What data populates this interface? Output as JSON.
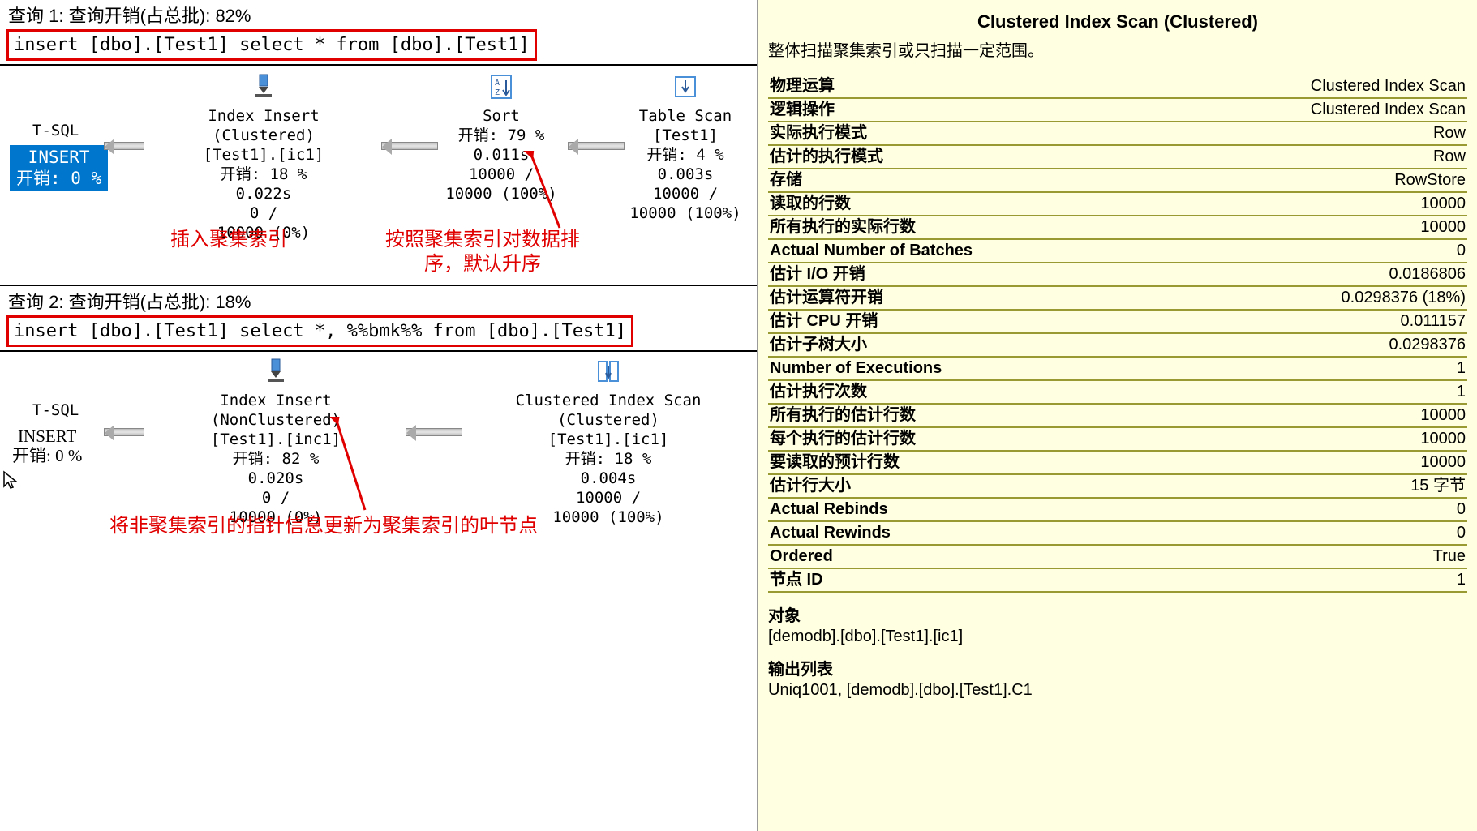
{
  "q1": {
    "header": "查询 1: 查询开销(占总批): 82%",
    "sql": "insert [dbo].[Test1] select * from [dbo].[Test1]",
    "tsql": "T-SQL",
    "insert_label": "INSERT",
    "insert_cost": "开销: 0 %",
    "op_index": {
      "title": "Index Insert (Clustered)",
      "obj": "[Test1].[ic1]",
      "cost": "开销: 18 %",
      "time": "0.022s",
      "rows1": "0 /",
      "rows2": "10000 (0%)"
    },
    "op_sort": {
      "title": "Sort",
      "cost": "开销: 79 %",
      "time": "0.011s",
      "rows1": "10000 /",
      "rows2": "10000 (100%)"
    },
    "op_scan": {
      "title": "Table Scan",
      "obj": "[Test1]",
      "cost": "开销: 4 %",
      "time": "0.003s",
      "rows1": "10000 /",
      "rows2": "10000 (100%)"
    },
    "note1": "插入聚集索引",
    "note2a": "按照聚集索引对数据排",
    "note2b": "序，默认升序"
  },
  "q2": {
    "header": "查询 2: 查询开销(占总批): 18%",
    "sql": "insert [dbo].[Test1] select *, %%bmk%% from [dbo].[Test1]",
    "tsql": "T-SQL",
    "insert_label": "INSERT",
    "insert_cost": "开销: 0 %",
    "op_index": {
      "title": "Index Insert (NonClustered)",
      "obj": "[Test1].[inc1]",
      "cost": "开销: 82 %",
      "time": "0.020s",
      "rows1": "0 /",
      "rows2": "10000 (0%)"
    },
    "op_scan": {
      "title": "Clustered Index Scan (Clustered)",
      "obj": "[Test1].[ic1]",
      "cost": "开销: 18 %",
      "time": "0.004s",
      "rows1": "10000 /",
      "rows2": "10000 (100%)"
    },
    "note": "将非聚集索引的指针信息更新为聚集索引的叶节点"
  },
  "right": {
    "title": "Clustered Index Scan (Clustered)",
    "desc": "整体扫描聚集索引或只扫描一定范围。",
    "props": [
      {
        "k": "物理运算",
        "v": "Clustered Index Scan"
      },
      {
        "k": "逻辑操作",
        "v": "Clustered Index Scan"
      },
      {
        "k": "实际执行模式",
        "v": "Row"
      },
      {
        "k": "估计的执行模式",
        "v": "Row"
      },
      {
        "k": "存储",
        "v": "RowStore"
      },
      {
        "k": "读取的行数",
        "v": "10000"
      },
      {
        "k": "所有执行的实际行数",
        "v": "10000"
      },
      {
        "k": "Actual Number of Batches",
        "v": "0"
      },
      {
        "k": "估计 I/O 开销",
        "v": "0.0186806"
      },
      {
        "k": "估计运算符开销",
        "v": "0.0298376 (18%)"
      },
      {
        "k": "估计 CPU 开销",
        "v": "0.011157"
      },
      {
        "k": "估计子树大小",
        "v": "0.0298376"
      },
      {
        "k": "Number of Executions",
        "v": "1"
      },
      {
        "k": "估计执行次数",
        "v": "1"
      },
      {
        "k": "所有执行的估计行数",
        "v": "10000"
      },
      {
        "k": "每个执行的估计行数",
        "v": "10000"
      },
      {
        "k": "要读取的预计行数",
        "v": "10000"
      },
      {
        "k": "估计行大小",
        "v": "15 字节"
      },
      {
        "k": "Actual Rebinds",
        "v": "0"
      },
      {
        "k": "Actual Rewinds",
        "v": "0"
      },
      {
        "k": "Ordered",
        "v": "True"
      },
      {
        "k": "节点 ID",
        "v": "1"
      }
    ],
    "obj_label": "对象",
    "obj_val": "[demodb].[dbo].[Test1].[ic1]",
    "out_label": "输出列表",
    "out_val": "Uniq1001, [demodb].[dbo].[Test1].C1"
  }
}
